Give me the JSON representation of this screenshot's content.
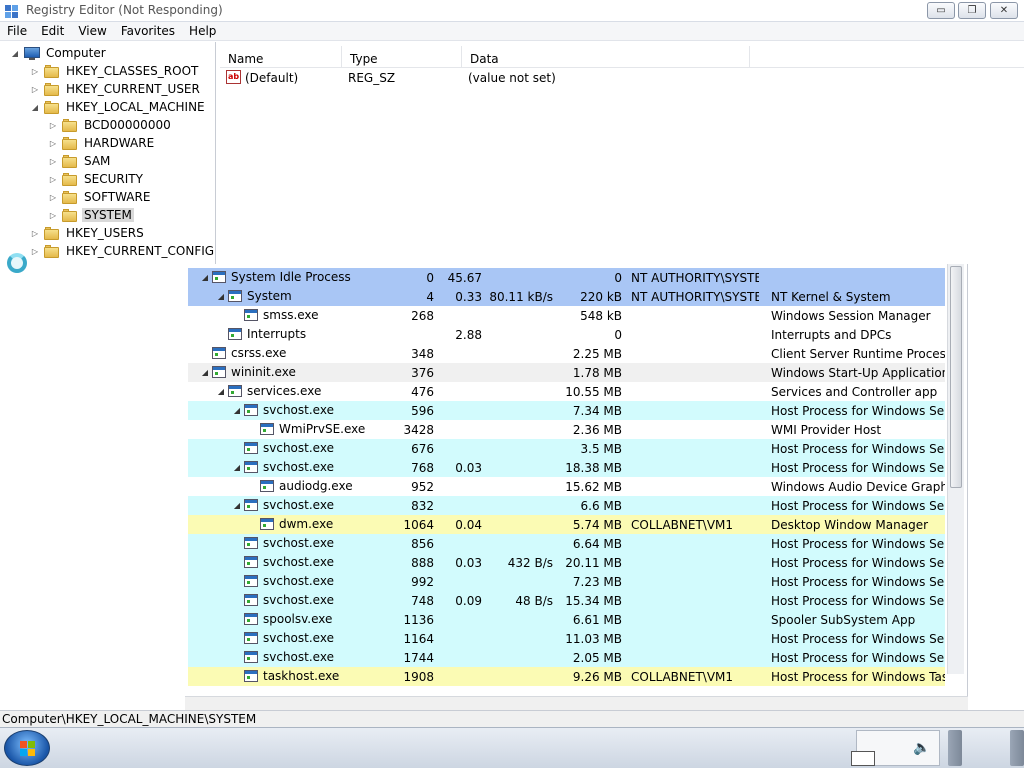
{
  "window": {
    "title": "Registry Editor (Not Responding)",
    "controls": {
      "minimize": "▭",
      "maximize": "❐",
      "close": "✕"
    }
  },
  "menu": [
    "File",
    "Edit",
    "View",
    "Favorites",
    "Help"
  ],
  "tree": [
    {
      "label": "Computer",
      "expander": "◢",
      "type": "computer"
    },
    {
      "label": "HKEY_CLASSES_ROOT",
      "expander": "▷",
      "type": "folder"
    },
    {
      "label": "HKEY_CURRENT_USER",
      "expander": "▷",
      "type": "folder"
    },
    {
      "label": "HKEY_LOCAL_MACHINE",
      "expander": "◢",
      "type": "folder"
    },
    {
      "label": "BCD00000000",
      "expander": "▷",
      "type": "folder"
    },
    {
      "label": "HARDWARE",
      "expander": "▷",
      "type": "folder"
    },
    {
      "label": "SAM",
      "expander": "▷",
      "type": "folder"
    },
    {
      "label": "SECURITY",
      "expander": "▷",
      "type": "folder"
    },
    {
      "label": "SOFTWARE",
      "expander": "▷",
      "type": "folder"
    },
    {
      "label": "SYSTEM",
      "expander": "▷",
      "type": "folder",
      "selected": true
    },
    {
      "label": "HKEY_USERS",
      "expander": "▷",
      "type": "folder"
    },
    {
      "label": "HKEY_CURRENT_CONFIG",
      "expander": "▷",
      "type": "folder"
    }
  ],
  "values_list": {
    "columns": [
      "Name",
      "Type",
      "Data"
    ],
    "rows": [
      {
        "name": "(Default)",
        "type": "REG_SZ",
        "data": "(value not set)",
        "icon": "ab"
      }
    ]
  },
  "processes": [
    {
      "exp": "◢",
      "name": "System Idle Process",
      "pid": "0",
      "cpu": "45.67",
      "io": "",
      "mem": "0",
      "user": "NT AUTHORITY\\SYSTEM",
      "desc": "",
      "bg": "#a9c6f5"
    },
    {
      "exp": "◢",
      "name": "System",
      "pid": "4",
      "cpu": "0.33",
      "io": "80.11 kB/s",
      "mem": "220 kB",
      "user": "NT AUTHORITY\\SYSTEM",
      "desc": "NT Kernel & System",
      "bg": "#a9c6f5"
    },
    {
      "exp": "",
      "name": "smss.exe",
      "pid": "268",
      "cpu": "",
      "io": "",
      "mem": "548 kB",
      "user": "",
      "desc": "Windows Session Manager",
      "bg": "#ffffff"
    },
    {
      "exp": "",
      "name": "Interrupts",
      "pid": "",
      "cpu": "2.88",
      "io": "",
      "mem": "0",
      "user": "",
      "desc": "Interrupts and DPCs",
      "bg": "#ffffff"
    },
    {
      "exp": "",
      "name": "csrss.exe",
      "pid": "348",
      "cpu": "",
      "io": "",
      "mem": "2.25 MB",
      "user": "",
      "desc": "Client Server Runtime Process",
      "bg": "#ffffff"
    },
    {
      "exp": "◢",
      "name": "wininit.exe",
      "pid": "376",
      "cpu": "",
      "io": "",
      "mem": "1.78 MB",
      "user": "",
      "desc": "Windows Start-Up Application",
      "bg": "#f0f0f0"
    },
    {
      "exp": "◢",
      "name": "services.exe",
      "pid": "476",
      "cpu": "",
      "io": "",
      "mem": "10.55 MB",
      "user": "",
      "desc": "Services and Controller app",
      "bg": "#ffffff"
    },
    {
      "exp": "◢",
      "name": "svchost.exe",
      "pid": "596",
      "cpu": "",
      "io": "",
      "mem": "7.34 MB",
      "user": "",
      "desc": "Host Process for Windows Ser...",
      "bg": "#d2fbfd"
    },
    {
      "exp": "",
      "name": "WmiPrvSE.exe",
      "pid": "3428",
      "cpu": "",
      "io": "",
      "mem": "2.36 MB",
      "user": "",
      "desc": "WMI Provider Host",
      "bg": "#ffffff"
    },
    {
      "exp": "",
      "name": "svchost.exe",
      "pid": "676",
      "cpu": "",
      "io": "",
      "mem": "3.5 MB",
      "user": "",
      "desc": "Host Process for Windows Ser...",
      "bg": "#d2fbfd"
    },
    {
      "exp": "◢",
      "name": "svchost.exe",
      "pid": "768",
      "cpu": "0.03",
      "io": "",
      "mem": "18.38 MB",
      "user": "",
      "desc": "Host Process for Windows Ser...",
      "bg": "#d2fbfd"
    },
    {
      "exp": "",
      "name": "audiodg.exe",
      "pid": "952",
      "cpu": "",
      "io": "",
      "mem": "15.62 MB",
      "user": "",
      "desc": "Windows Audio Device Graph...",
      "bg": "#ffffff"
    },
    {
      "exp": "◢",
      "name": "svchost.exe",
      "pid": "832",
      "cpu": "",
      "io": "",
      "mem": "6.6 MB",
      "user": "",
      "desc": "Host Process for Windows Ser...",
      "bg": "#d2fbfd"
    },
    {
      "exp": "",
      "name": "dwm.exe",
      "pid": "1064",
      "cpu": "0.04",
      "io": "",
      "mem": "5.74 MB",
      "user": "COLLABNET\\VM1",
      "desc": "Desktop Window Manager",
      "bg": "#fbfbb4"
    },
    {
      "exp": "",
      "name": "svchost.exe",
      "pid": "856",
      "cpu": "",
      "io": "",
      "mem": "6.64 MB",
      "user": "",
      "desc": "Host Process for Windows Ser...",
      "bg": "#d2fbfd"
    },
    {
      "exp": "",
      "name": "svchost.exe",
      "pid": "888",
      "cpu": "0.03",
      "io": "432 B/s",
      "mem": "20.11 MB",
      "user": "",
      "desc": "Host Process for Windows Ser...",
      "bg": "#d2fbfd"
    },
    {
      "exp": "",
      "name": "svchost.exe",
      "pid": "992",
      "cpu": "",
      "io": "",
      "mem": "7.23 MB",
      "user": "",
      "desc": "Host Process for Windows Ser...",
      "bg": "#d2fbfd"
    },
    {
      "exp": "",
      "name": "svchost.exe",
      "pid": "748",
      "cpu": "0.09",
      "io": "48 B/s",
      "mem": "15.34 MB",
      "user": "",
      "desc": "Host Process for Windows Ser...",
      "bg": "#d2fbfd"
    },
    {
      "exp": "",
      "name": "spoolsv.exe",
      "pid": "1136",
      "cpu": "",
      "io": "",
      "mem": "6.61 MB",
      "user": "",
      "desc": "Spooler SubSystem App",
      "bg": "#d2fbfd"
    },
    {
      "exp": "",
      "name": "svchost.exe",
      "pid": "1164",
      "cpu": "",
      "io": "",
      "mem": "11.03 MB",
      "user": "",
      "desc": "Host Process for Windows Ser...",
      "bg": "#d2fbfd"
    },
    {
      "exp": "",
      "name": "svchost.exe",
      "pid": "1744",
      "cpu": "",
      "io": "",
      "mem": "2.05 MB",
      "user": "",
      "desc": "Host Process for Windows Ser...",
      "bg": "#d2fbfd"
    },
    {
      "exp": "",
      "name": "taskhost.exe",
      "pid": "1908",
      "cpu": "",
      "io": "",
      "mem": "9.26 MB",
      "user": "COLLABNET\\VM1",
      "desc": "Host Process for Windows Tas...",
      "bg": "#fbfbb4"
    }
  ],
  "statusbar": {
    "path": "Computer\\HKEY_LOCAL_MACHINE\\SYSTEM"
  },
  "taskbar": {
    "volume_icon": "🔈"
  }
}
